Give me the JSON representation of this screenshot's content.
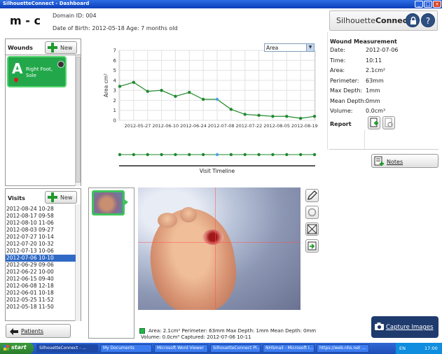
{
  "window": {
    "title": "SilhouetteConnect - Dashboard",
    "min": "_",
    "max": "□",
    "close": "×"
  },
  "patient": {
    "name": "m - c",
    "domain": "Domain ID: 004",
    "dob": "Date of Birth: 2012-05-18 Age: 7 months old"
  },
  "logo": {
    "prefix": "Silhouette",
    "bold": "Connect"
  },
  "wounds": {
    "title": "Wounds",
    "new_label": "New",
    "card": {
      "letter": "A",
      "label_line1": "Right Foot,",
      "label_line2": "Sole"
    }
  },
  "visits": {
    "title": "Visits",
    "new_label": "New",
    "items": [
      "2012-08-24 10-28",
      "2012-08-17 09-58",
      "2012-08-10 11-06",
      "2012-08-03 09-27",
      "2012-07-27 10-14",
      "2012-07-20 10-32",
      "2012-07-13 10-06",
      "2012-07-06 10-10",
      "2012-06-29 09-06",
      "2012-06-22 10-00",
      "2012-06-15 09-40",
      "2012-06-08 12-18",
      "2012-06-01 10-18",
      "2012-05-25 11-52",
      "2012-05-18 11-50"
    ],
    "selected_index": 7
  },
  "patients_button": "Patients",
  "chart_data": {
    "type": "line",
    "ylabel": "Area cm²",
    "xlabel": "Visit Timeline",
    "ylim": [
      0,
      7
    ],
    "yticks": [
      0,
      1,
      2,
      3,
      4,
      5,
      6,
      7
    ],
    "x_ticks": [
      "2012-05-27",
      "2012-06-10",
      "2012-06-24",
      "2012-07-08",
      "2012-07-22",
      "2012-08-05",
      "2012-08-19"
    ],
    "x": [
      "2012-05-18",
      "2012-05-25",
      "2012-06-01",
      "2012-06-08",
      "2012-06-15",
      "2012-06-22",
      "2012-06-29",
      "2012-07-06",
      "2012-07-13",
      "2012-07-20",
      "2012-07-27",
      "2012-08-03",
      "2012-08-10",
      "2012-08-17",
      "2012-08-24"
    ],
    "values": [
      3.4,
      3.8,
      2.9,
      3.0,
      2.4,
      2.8,
      2.1,
      2.1,
      1.1,
      0.6,
      0.5,
      0.4,
      0.4,
      0.2,
      0.4
    ],
    "selected_index": 7,
    "grid": true,
    "line_color": "#1f8a2e",
    "selected_color": "#4aa3e0",
    "selector_value": "Area"
  },
  "measurement": {
    "title": "Wound Measurement",
    "rows": [
      {
        "label": "Date:",
        "value": "2012-07-06"
      },
      {
        "label": "Time:",
        "value": "10:11"
      },
      {
        "label": "Area:",
        "value": "2.1cm²"
      },
      {
        "label": "Perimeter:",
        "value": "63mm"
      },
      {
        "label": "Max Depth:",
        "value": "1mm"
      },
      {
        "label": "Mean Depth:",
        "value": "0mm"
      },
      {
        "label": "Volume:",
        "value": "0.0cm³"
      }
    ],
    "report_label": "Report",
    "notes_label": "Notes"
  },
  "image_caption": {
    "line1": "Area: 2.1cm²  Perimeter: 63mm  Max Depth: 1mm  Mean Depth: 0mm",
    "line2": "Volume: 0.0cm³  Captured: 2012-07-06 10-11"
  },
  "capture_label": "Capture Images",
  "taskbar": {
    "start": "start",
    "tasks": [
      "SilhouetteConnect - ...",
      "My Documents",
      "Microsoft Word Viewer",
      "SilhouetteConnect Pl...",
      "NHSmail - Microsoft I...",
      "https://web.nhs.net ..."
    ],
    "tray_lang": "EN",
    "clock": "17:00"
  }
}
